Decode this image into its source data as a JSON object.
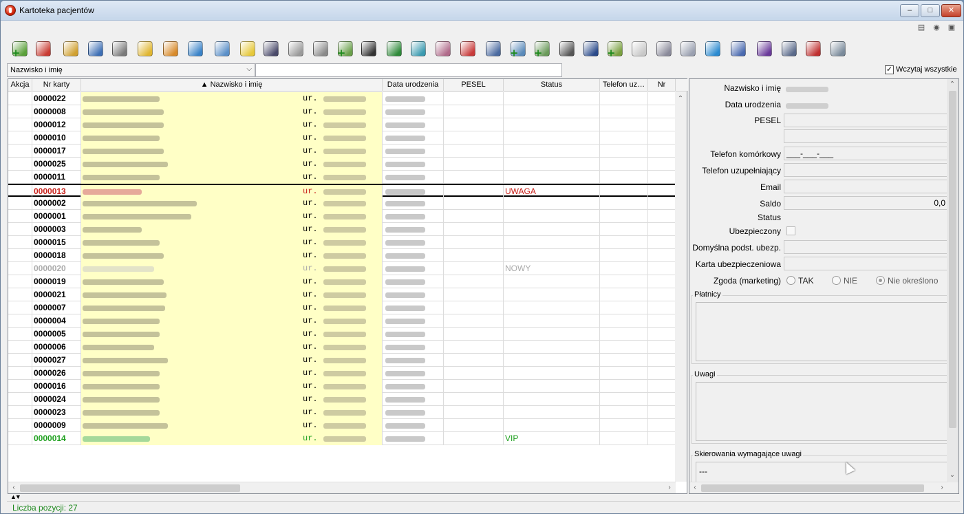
{
  "window": {
    "title": "Kartoteka pacjentów"
  },
  "filter": {
    "field_selected": "Nazwisko i imię",
    "search_value": "",
    "load_all_label": "Wczytaj wszystkie",
    "load_all_checked": true
  },
  "columns": [
    "Akcja",
    "Nr karty",
    "▲ Nazwisko i imię",
    "Data urodzenia",
    "PESEL",
    "Status",
    "Telefon uz…",
    "Nr"
  ],
  "rows": [
    {
      "nr": "0000022",
      "ur": "ur.",
      "status": "",
      "style": ""
    },
    {
      "nr": "0000008",
      "ur": "ur.",
      "status": "",
      "style": ""
    },
    {
      "nr": "0000012",
      "ur": "ur.",
      "status": "",
      "style": ""
    },
    {
      "nr": "0000010",
      "ur": "ur.",
      "status": "",
      "style": ""
    },
    {
      "nr": "0000017",
      "ur": "ur.",
      "status": "",
      "style": ""
    },
    {
      "nr": "0000025",
      "ur": "ur.",
      "status": "",
      "style": ""
    },
    {
      "nr": "0000011",
      "ur": "ur.",
      "status": "",
      "style": ""
    },
    {
      "nr": "0000013",
      "ur": "ur.",
      "status": "UWAGA",
      "style": "red selected"
    },
    {
      "nr": "0000002",
      "ur": "ur.",
      "status": "",
      "style": ""
    },
    {
      "nr": "0000001",
      "ur": "ur.",
      "status": "",
      "style": ""
    },
    {
      "nr": "0000003",
      "ur": "ur.",
      "status": "",
      "style": ""
    },
    {
      "nr": "0000015",
      "ur": "ur.",
      "status": "",
      "style": ""
    },
    {
      "nr": "0000018",
      "ur": "ur.",
      "status": "",
      "style": ""
    },
    {
      "nr": "0000020",
      "ur": "ur.",
      "status": "NOWY",
      "style": "gray"
    },
    {
      "nr": "0000019",
      "ur": "ur.",
      "status": "",
      "style": ""
    },
    {
      "nr": "0000021",
      "ur": "ur.",
      "status": "",
      "style": ""
    },
    {
      "nr": "0000007",
      "ur": "ur.",
      "status": "",
      "style": ""
    },
    {
      "nr": "0000004",
      "ur": "ur.",
      "status": "",
      "style": ""
    },
    {
      "nr": "0000005",
      "ur": "ur.",
      "status": "",
      "style": ""
    },
    {
      "nr": "0000006",
      "ur": "ur.",
      "status": "",
      "style": ""
    },
    {
      "nr": "0000027",
      "ur": "ur.",
      "status": "",
      "style": ""
    },
    {
      "nr": "0000026",
      "ur": "ur.",
      "status": "",
      "style": ""
    },
    {
      "nr": "0000016",
      "ur": "ur.",
      "status": "",
      "style": ""
    },
    {
      "nr": "0000024",
      "ur": "ur.",
      "status": "",
      "style": ""
    },
    {
      "nr": "0000023",
      "ur": "ur.",
      "status": "",
      "style": ""
    },
    {
      "nr": "0000009",
      "ur": "ur.",
      "status": "",
      "style": ""
    },
    {
      "nr": "0000014",
      "ur": "ur.",
      "status": "VIP",
      "style": "green"
    }
  ],
  "details": {
    "name_label": "Nazwisko i imię",
    "dob_label": "Data urodzenia",
    "pesel_label": "PESEL",
    "mobile_label": "Telefon komórkowy",
    "mobile_value": "___-___-___",
    "phone2_label": "Telefon uzupełniający",
    "email_label": "Email",
    "saldo_label": "Saldo",
    "saldo_value": "0,0",
    "status_label": "Status",
    "insured_label": "Ubezpieczony",
    "default_insurance_label": "Domyślna podst. ubezp.",
    "insurance_card_label": "Karta ubezpieczeniowa",
    "consent_label": "Zgoda (marketing)",
    "consent_options": [
      "TAK",
      "NIE",
      "Nie określono"
    ],
    "consent_selected": "Nie określono",
    "payers_title": "Płatnicy",
    "notes_title": "Uwagi",
    "referrals_title": "Skierowania wymagające uwagi",
    "referrals_value": "---"
  },
  "statusbar": {
    "count_text": "Liczba pozycji: 27"
  },
  "toolbar_icons": [
    "add-patient-icon",
    "remove-patient-icon",
    "edit-patient-icon",
    "card-icon",
    "patient-search-icon",
    "folder-user-icon",
    "patient-money-icon",
    "calendar-icon",
    "patient-edit-icon",
    "sad-face-icon",
    "patient-card-icon",
    "document-icon",
    "attachment-icon",
    "add-attachment-icon",
    "barcode-icon",
    "checklist-icon",
    "stethoscope-icon",
    "patient-report-icon",
    "test-tubes-icon",
    "syringe-icon",
    "add-folder-icon",
    "add-document-icon",
    "cabinet-icon",
    "pen-icon",
    "add-user-icon",
    "envelope-icon",
    "printer-icon",
    "gears-icon",
    "refresh-icon",
    "columns-icon",
    "sum-icon",
    "print-list-icon",
    "warning-checklist-icon",
    "report-icon"
  ]
}
